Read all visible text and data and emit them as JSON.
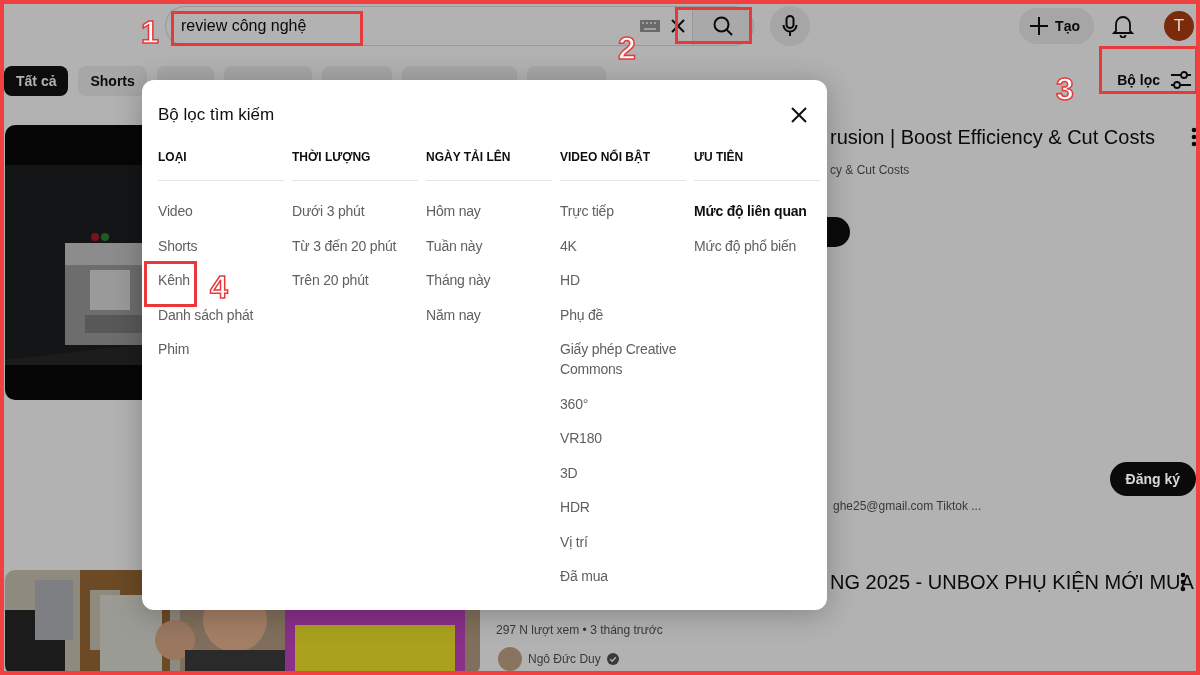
{
  "search": {
    "value": "review công nghệ"
  },
  "topbar": {
    "create_label": "Tạo",
    "avatar_letter": "T"
  },
  "chips": [
    {
      "label": "Tất cả",
      "selected": true
    },
    {
      "label": "Shorts",
      "selected": false
    },
    {
      "selected": false
    },
    {
      "selected": false
    },
    {
      "selected": false
    },
    {
      "selected": false
    },
    {
      "selected": false
    }
  ],
  "filter_button": {
    "label": "Bộ lọc"
  },
  "results": [
    {
      "kind": "video",
      "title": "rusion | Boost Efficiency & Cut Costs",
      "snippet": "cy & Cut Costs"
    },
    {
      "kind": "channel",
      "subscribe_label": "Đăng ký",
      "description": "ghe25@gmail.com Tiktok ..."
    },
    {
      "kind": "video",
      "title": "NG 2025 - UNBOX PHỤ KIỆN MỚI MUA",
      "meta": "297 N lượt xem • 3 tháng trước",
      "channel": "Ngô Đức Duy",
      "verified": true
    }
  ],
  "dialog": {
    "title": "Bộ lọc tìm kiếm",
    "groups": [
      {
        "heading": "LOẠI",
        "options": [
          {
            "label": "Video",
            "selected": false
          },
          {
            "label": "Shorts",
            "selected": false
          },
          {
            "label": "Kênh",
            "selected": false
          },
          {
            "label": "Danh sách phát",
            "selected": false
          },
          {
            "label": "Phim",
            "selected": false
          }
        ]
      },
      {
        "heading": "THỜI LƯỢNG",
        "options": [
          {
            "label": "Dưới 3 phút",
            "selected": false
          },
          {
            "label": "Từ 3 đến 20 phút",
            "selected": false
          },
          {
            "label": "Trên 20 phút",
            "selected": false
          }
        ]
      },
      {
        "heading": "NGÀY TẢI LÊN",
        "options": [
          {
            "label": "Hôm nay",
            "selected": false
          },
          {
            "label": "Tuần này",
            "selected": false
          },
          {
            "label": "Tháng này",
            "selected": false
          },
          {
            "label": "Năm nay",
            "selected": false
          }
        ]
      },
      {
        "heading": "VIDEO NỔI BẬT",
        "options": [
          {
            "label": "Trực tiếp",
            "selected": false
          },
          {
            "label": "4K",
            "selected": false
          },
          {
            "label": "HD",
            "selected": false
          },
          {
            "label": "Phụ đề",
            "selected": false
          },
          {
            "label": "Giấy phép Creative Commons",
            "selected": false
          },
          {
            "label": "360°",
            "selected": false
          },
          {
            "label": "VR180",
            "selected": false
          },
          {
            "label": "3D",
            "selected": false
          },
          {
            "label": "HDR",
            "selected": false
          },
          {
            "label": "Vị trí",
            "selected": false
          },
          {
            "label": "Đã mua",
            "selected": false
          }
        ]
      },
      {
        "heading": "ƯU TIÊN",
        "options": [
          {
            "label": "Mức độ liên quan",
            "selected": true
          },
          {
            "label": "Mức độ phổ biến",
            "selected": false
          }
        ]
      }
    ]
  },
  "annotations": [
    {
      "label": "1"
    },
    {
      "label": "2"
    },
    {
      "label": "3"
    },
    {
      "label": "4"
    }
  ]
}
